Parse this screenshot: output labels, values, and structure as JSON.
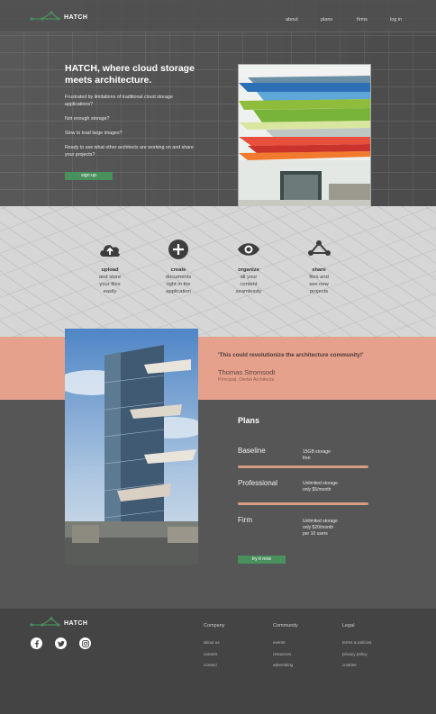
{
  "brand": {
    "name": "HATCH",
    "accent": "#4a8f5e",
    "logo_icon": "network-logo-icon"
  },
  "nav": {
    "links": [
      "about",
      "plans",
      "firms",
      "log in"
    ]
  },
  "hero": {
    "title": "HATCH, where cloud storage meets architecture.",
    "paragraphs": [
      "Frustrated by limitations of traditional cloud storage applications?",
      "Not enough storage?",
      "Slow to load large images?",
      "Ready to see what other architects are working on and share your projects?"
    ],
    "cta": "sign up"
  },
  "features": [
    {
      "icon": "upload-cloud-icon",
      "title": "upload",
      "desc": [
        "and store",
        "your files",
        "easily"
      ]
    },
    {
      "icon": "plus-circle-icon",
      "title": "create",
      "desc": [
        "documents",
        "right in the",
        "application"
      ]
    },
    {
      "icon": "eye-icon",
      "title": "organize",
      "desc": [
        "all your",
        "content",
        "seamlessly"
      ]
    },
    {
      "icon": "share-icon",
      "title": "share",
      "desc": [
        "files and",
        "see new",
        "projects"
      ]
    }
  ],
  "testimonial": {
    "quote": "'This could revolutionize the architecture community!'",
    "name": "Thomas Stromsodt",
    "role": "Principal, Oertel Architects"
  },
  "plans": {
    "title": "Plans",
    "items": [
      {
        "name": "Baseline",
        "details": [
          "15GB storage",
          "free"
        ]
      },
      {
        "name": "Professional",
        "details": [
          "Unlimited storage",
          "only $5/month"
        ]
      },
      {
        "name": "Firm",
        "details": [
          "Unlimited storage",
          "only $20/month",
          "per 10 users"
        ]
      }
    ],
    "cta": "try it now"
  },
  "footer": {
    "social": [
      "facebook-icon",
      "twitter-icon",
      "instagram-icon"
    ],
    "columns": [
      {
        "title": "Company",
        "links": [
          "about us",
          "careers",
          "contact"
        ]
      },
      {
        "title": "Community",
        "links": [
          "events",
          "resources",
          "advertising"
        ]
      },
      {
        "title": "Legal",
        "links": [
          "terms & policies",
          "privacy policy",
          "cookies"
        ]
      }
    ]
  },
  "colors": {
    "hero_bg": "#5a5a5a",
    "features_bg": "#d6d6d6",
    "testimonial_bg": "#e6a18c",
    "plans_bg": "#565656",
    "plan_bar": "#d79c84",
    "footer_bg": "#444444"
  }
}
